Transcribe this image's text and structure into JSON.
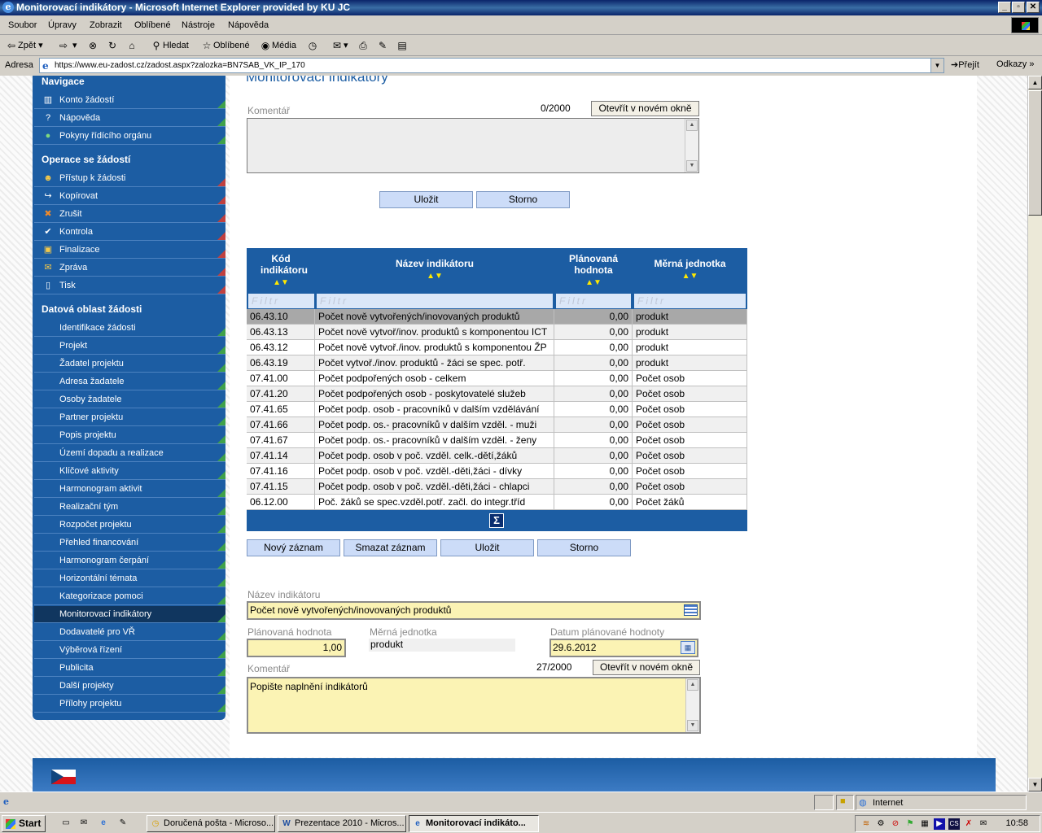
{
  "window": {
    "title": "Monitorovací indikátory - Microsoft Internet Explorer provided by KU JC"
  },
  "menu": [
    "Soubor",
    "Úpravy",
    "Zobrazit",
    "Oblíbené",
    "Nástroje",
    "Nápověda"
  ],
  "toolbar": {
    "back": "Zpět",
    "search": "Hledat",
    "favorites": "Oblíbené",
    "media": "Média"
  },
  "address": {
    "label": "Adresa",
    "url": "https://www.eu-zadost.cz/zadost.aspx?zalozka=BN7SAB_VK_IP_170",
    "go": "Přejít",
    "links": "Odkazy"
  },
  "nav": {
    "sections": {
      "navigace": "Navigace",
      "operace": "Operace se žádostí",
      "datova": "Datová oblast žádosti"
    },
    "navigace_items": [
      {
        "label": "Konto žádostí",
        "icon": "account-icon"
      },
      {
        "label": "Nápověda",
        "icon": "help-icon"
      },
      {
        "label": "Pokyny řídícího orgánu",
        "icon": "info-icon"
      }
    ],
    "operace_items": [
      {
        "label": "Přístup k žádosti",
        "icon": "users-icon"
      },
      {
        "label": "Kopírovat",
        "icon": "copy-arrow-icon"
      },
      {
        "label": "Zrušit",
        "icon": "cancel-icon"
      },
      {
        "label": "Kontrola",
        "icon": "check-icon"
      },
      {
        "label": "Finalizace",
        "icon": "lock-icon"
      },
      {
        "label": "Zpráva",
        "icon": "envelope-icon"
      },
      {
        "label": "Tisk",
        "icon": "print-icon"
      }
    ],
    "datova_items": [
      "Identifikace žádosti",
      "Projekt",
      "Žadatel projektu",
      "Adresa žadatele",
      "Osoby žadatele",
      "Partner projektu",
      "Popis projektu",
      "Území dopadu a realizace",
      "Klíčové aktivity",
      "Harmonogram aktivit",
      "Realizační tým",
      "Rozpočet projektu",
      "Přehled financování",
      "Harmonogram čerpání",
      "Horizontální témata",
      "Kategorizace pomoci",
      "Monitorovací indikátory",
      "Dodavatelé pro VŘ",
      "Výběrová řízení",
      "Publicita",
      "Další projekty",
      "Přílohy projektu"
    ]
  },
  "main": {
    "title": "Monitorovací indikátory",
    "top_comment": {
      "label": "Komentář",
      "counter": "0/2000",
      "open_button": "Otevřít v novém okně",
      "value": ""
    },
    "save_button": "Uložit",
    "cancel_button": "Storno",
    "grid": {
      "headers": {
        "code": "Kód indikátoru",
        "name": "Název indikátoru",
        "planned": "Plánovaná hodnota",
        "unit": "Měrná jednotka"
      },
      "filter_placeholder": "Filtr",
      "rows": [
        {
          "code": "06.43.10",
          "name": "Počet nově vytvořených/inovovaných produktů",
          "value": "0,00",
          "unit": "produkt"
        },
        {
          "code": "06.43.13",
          "name": "Počet nově vytvoř/inov. produktů s komponentou ICT",
          "value": "0,00",
          "unit": "produkt"
        },
        {
          "code": "06.43.12",
          "name": "Počet nově vytvoř./inov. produktů s komponentou ŽP",
          "value": "0,00",
          "unit": "produkt"
        },
        {
          "code": "06.43.19",
          "name": "Počet vytvoř./inov. produktů - žáci se spec. potř.",
          "value": "0,00",
          "unit": "produkt"
        },
        {
          "code": "07.41.00",
          "name": "Počet podpořených osob - celkem",
          "value": "0,00",
          "unit": "Počet osob"
        },
        {
          "code": "07.41.20",
          "name": "Počet podpořených osob - poskytovatelé služeb",
          "value": "0,00",
          "unit": "Počet osob"
        },
        {
          "code": "07.41.65",
          "name": "Počet podp. osob - pracovníků v dalším vzdělávání",
          "value": "0,00",
          "unit": "Počet osob"
        },
        {
          "code": "07.41.66",
          "name": "Počet podp. os.- pracovníků v dalším vzděl. - muži",
          "value": "0,00",
          "unit": "Počet osob"
        },
        {
          "code": "07.41.67",
          "name": "Počet podp. os.- pracovníků v dalším vzděl. - ženy",
          "value": "0,00",
          "unit": "Počet osob"
        },
        {
          "code": "07.41.14",
          "name": "Počet podp. osob v poč. vzděl. celk.-dětí,žáků",
          "value": "0,00",
          "unit": "Počet osob"
        },
        {
          "code": "07.41.16",
          "name": "Počet podp. osob v poč. vzděl.-děti,žáci - dívky",
          "value": "0,00",
          "unit": "Počet osob"
        },
        {
          "code": "07.41.15",
          "name": "Počet podp. osob v poč. vzděl.-děti,žáci - chlapci",
          "value": "0,00",
          "unit": "Počet osob"
        },
        {
          "code": "06.12.00",
          "name": "Poč. žáků se spec.vzděl.potř. začl. do integr.tříd",
          "value": "0,00",
          "unit": "Počet žáků"
        }
      ],
      "sum_symbol": "Σ"
    },
    "grid_buttons": {
      "new": "Nový záznam",
      "delete": "Smazat záznam",
      "save": "Uložit",
      "cancel": "Storno"
    },
    "detail": {
      "name_label": "Název indikátoru",
      "name_value": "Počet nově vytvořených/inovovaných produktů",
      "planned_label": "Plánovaná hodnota",
      "planned_value": "1,00",
      "unit_label": "Měrná jednotka",
      "unit_value": "produkt",
      "date_label": "Datum plánované hodnoty",
      "date_value": "29.6.2012",
      "comment_label": "Komentář",
      "comment_counter": "27/2000",
      "open_button": "Otevřít v novém okně",
      "comment_value": "Popište naplnění indikátorů"
    }
  },
  "status": {
    "zone": "Internet"
  },
  "taskbar": {
    "start": "Start",
    "tasks": [
      "Doručená pošta - Microso...",
      "Prezentace 2010 - Micros...",
      "Monitorovací indikáto..."
    ],
    "clock": "10:58"
  },
  "colors": {
    "accent": "#1c5da3",
    "field_yellow": "#fbf3b4",
    "button_blue": "#ccdcf8",
    "selected_row": "#a8a8a8"
  }
}
